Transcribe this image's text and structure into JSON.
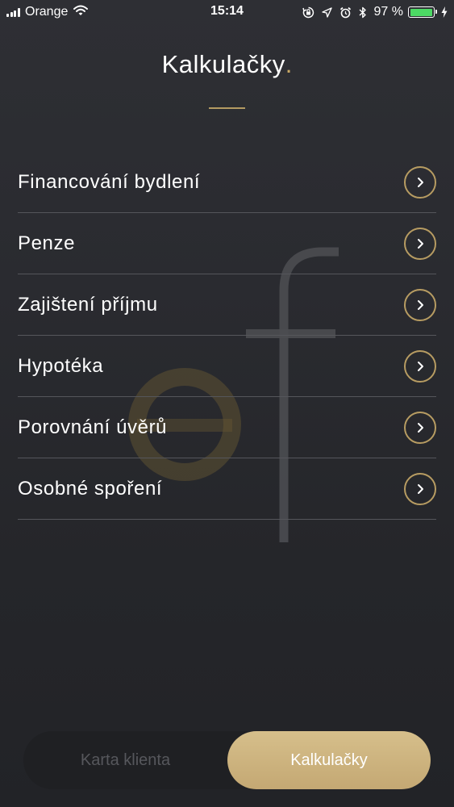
{
  "status_bar": {
    "carrier": "Orange",
    "time": "15:14",
    "battery_percent": "97 %",
    "battery_level": 0.97,
    "icons": [
      "signal-icon",
      "wifi-icon",
      "orientation-lock-icon",
      "location-icon",
      "alarm-icon",
      "bluetooth-icon",
      "battery-icon",
      "charging-icon"
    ]
  },
  "header": {
    "title": "Kalkulačky",
    "title_dot": "."
  },
  "calculators": [
    {
      "label": "Financování bydlení"
    },
    {
      "label": "Penze"
    },
    {
      "label": "Zajištení příjmu"
    },
    {
      "label": "Hypotéka"
    },
    {
      "label": "Porovnání úvěrů"
    },
    {
      "label": "Osobné spoření"
    }
  ],
  "tabs": {
    "client_card": "Karta klienta",
    "calculators": "Kalkulačky",
    "active": "calculators"
  },
  "colors": {
    "accent": "#c9a965",
    "background": "#2a2b30",
    "active_tab": "#c9ae79",
    "inactive_tab_text": "#56575c",
    "battery": "#4cd964"
  }
}
